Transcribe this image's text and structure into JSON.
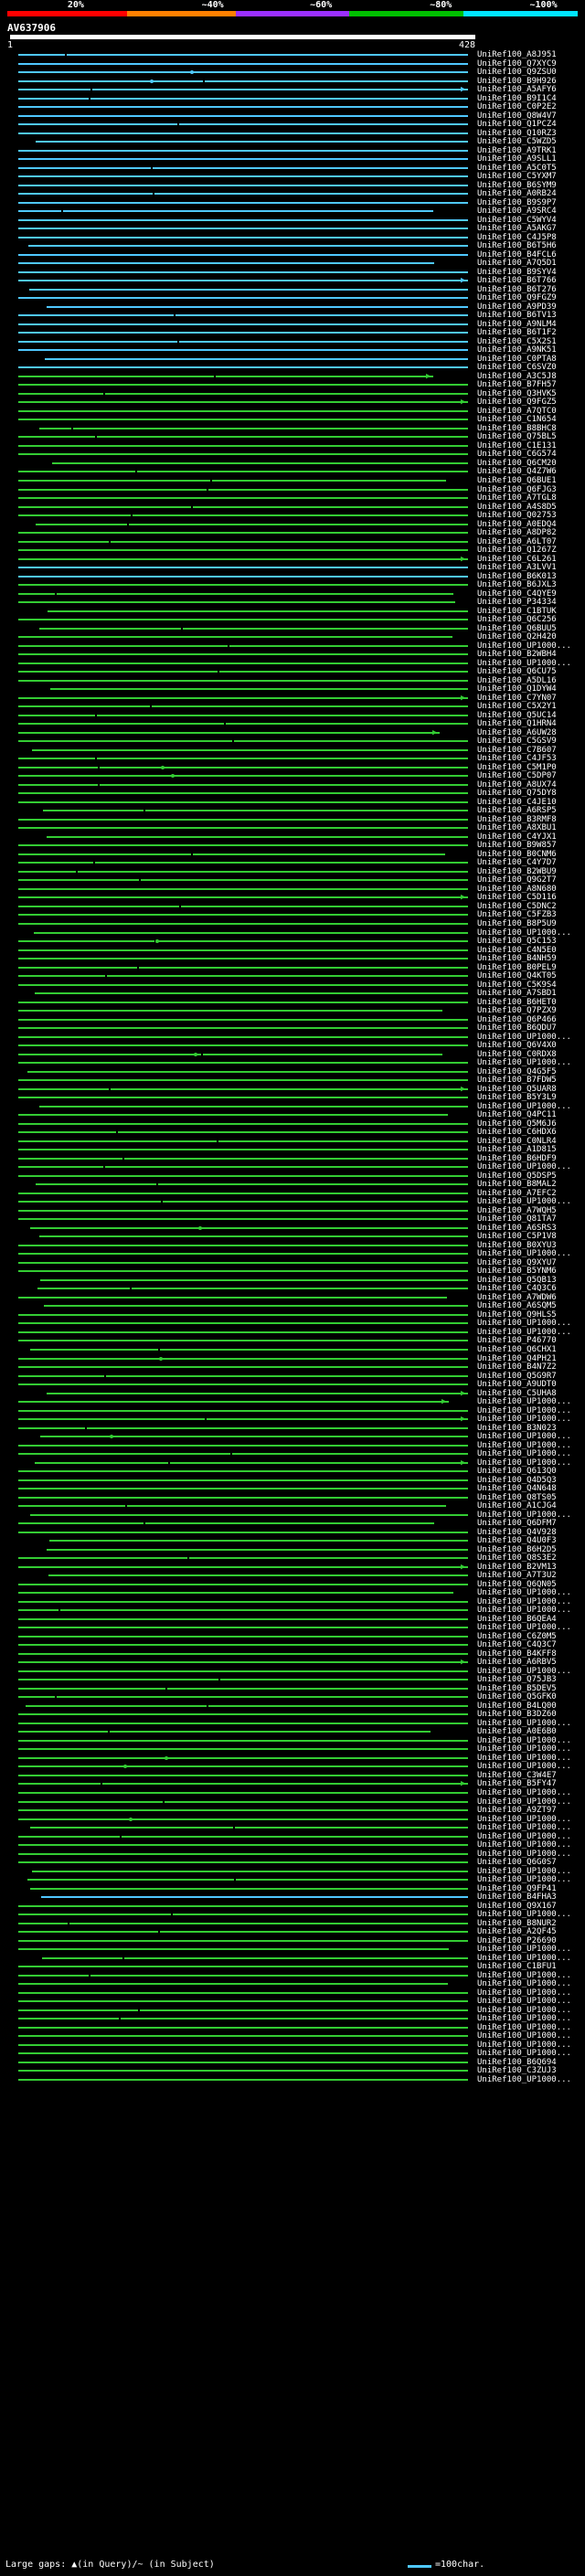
{
  "scale": {
    "labels": [
      "20%",
      "~40%",
      "~60%",
      "~80%",
      "~100%"
    ],
    "colors": [
      "#ff0000",
      "#ff8000",
      "#9b30ff",
      "#00c000",
      "#00e5ff"
    ]
  },
  "query": {
    "id": "AV637906",
    "start": "1",
    "end": "428"
  },
  "colors": {
    "green": "#33cc33",
    "cyan": "#4fc8ff",
    "dark_green": "#1a7a1a"
  },
  "hits": [
    {
      "acc": "UniRef100_A8J951",
      "color": "cyan"
    },
    {
      "acc": "UniRef100_Q7XYC9",
      "color": "cyan"
    },
    {
      "acc": "UniRef100_Q9ZSU0",
      "color": "cyan"
    },
    {
      "acc": "UniRef100_B9H926",
      "color": "cyan"
    },
    {
      "acc": "UniRef100_A5AFY6",
      "color": "cyan"
    },
    {
      "acc": "UniRef100_B9I1C4",
      "color": "cyan"
    },
    {
      "acc": "UniRef100_C0P2E2",
      "color": "cyan"
    },
    {
      "acc": "UniRef100_Q8W4V7",
      "color": "cyan"
    },
    {
      "acc": "UniRef100_Q1PCZ4",
      "color": "cyan"
    },
    {
      "acc": "UniRef100_Q10RZ3",
      "color": "cyan"
    },
    {
      "acc": "UniRef100_C5WZD5",
      "color": "cyan"
    },
    {
      "acc": "UniRef100_A9TRK1",
      "color": "cyan"
    },
    {
      "acc": "UniRef100_A9SLL1",
      "color": "cyan"
    },
    {
      "acc": "UniRef100_A5C0T5",
      "color": "cyan"
    },
    {
      "acc": "UniRef100_C5YXM7",
      "color": "cyan"
    },
    {
      "acc": "UniRef100_B6SYM9",
      "color": "cyan"
    },
    {
      "acc": "UniRef100_A0RB24",
      "color": "cyan"
    },
    {
      "acc": "UniRef100_B9S9P7",
      "color": "cyan"
    },
    {
      "acc": "UniRef100_A9SRC4",
      "color": "cyan"
    },
    {
      "acc": "UniRef100_C5WYV4",
      "color": "cyan"
    },
    {
      "acc": "UniRef100_A5AKG7",
      "color": "cyan"
    },
    {
      "acc": "UniRef100_C4J5P8",
      "color": "cyan"
    },
    {
      "acc": "UniRef100_B6T5H6",
      "color": "cyan"
    },
    {
      "acc": "UniRef100_B4FCL6",
      "color": "cyan"
    },
    {
      "acc": "UniRef100_A7Q5D1",
      "color": "cyan"
    },
    {
      "acc": "UniRef100_B9SYV4",
      "color": "cyan"
    },
    {
      "acc": "UniRef100_B6T766",
      "color": "cyan"
    },
    {
      "acc": "UniRef100_B6T276",
      "color": "cyan"
    },
    {
      "acc": "UniRef100_Q9FGZ9",
      "color": "cyan"
    },
    {
      "acc": "UniRef100_A9PD39",
      "color": "cyan"
    },
    {
      "acc": "UniRef100_B6TV13",
      "color": "cyan"
    },
    {
      "acc": "UniRef100_A9NLM4",
      "color": "cyan"
    },
    {
      "acc": "UniRef100_B6T1F2",
      "color": "cyan"
    },
    {
      "acc": "UniRef100_C5X2S1",
      "color": "cyan"
    },
    {
      "acc": "UniRef100_A9NK51",
      "color": "cyan"
    },
    {
      "acc": "UniRef100_C0PTA8",
      "color": "cyan"
    },
    {
      "acc": "UniRef100_C6SVZ0",
      "color": "cyan"
    },
    {
      "acc": "UniRef100_A3C5J8",
      "color": "green"
    },
    {
      "acc": "UniRef100_B7FH57",
      "color": "green"
    },
    {
      "acc": "UniRef100_Q3HVK5",
      "color": "green"
    },
    {
      "acc": "UniRef100_Q9FGZ5",
      "color": "green"
    },
    {
      "acc": "UniRef100_A7QTC0",
      "color": "green"
    },
    {
      "acc": "UniRef100_C1N654",
      "color": "green"
    },
    {
      "acc": "UniRef100_B8BHC8",
      "color": "green"
    },
    {
      "acc": "UniRef100_Q75BL5",
      "color": "green"
    },
    {
      "acc": "UniRef100_C1E131",
      "color": "green"
    },
    {
      "acc": "UniRef100_C6G574",
      "color": "green"
    },
    {
      "acc": "UniRef100_Q6CM20",
      "color": "green"
    },
    {
      "acc": "UniRef100_Q4Z7W6",
      "color": "green"
    },
    {
      "acc": "UniRef100_Q6BUE1",
      "color": "green"
    },
    {
      "acc": "UniRef100_Q6FJG3",
      "color": "green"
    },
    {
      "acc": "UniRef100_A7TGL8",
      "color": "green"
    },
    {
      "acc": "UniRef100_A4S8D5",
      "color": "green"
    },
    {
      "acc": "UniRef100_Q02753",
      "color": "green"
    },
    {
      "acc": "UniRef100_A0EDQ4",
      "color": "green"
    },
    {
      "acc": "UniRef100_A8DP82",
      "color": "green"
    },
    {
      "acc": "UniRef100_A6LT07",
      "color": "green"
    },
    {
      "acc": "UniRef100_Q1267Z",
      "color": "green"
    },
    {
      "acc": "UniRef100_C6L261",
      "color": "green"
    },
    {
      "acc": "UniRef100_A3LVV1",
      "color": "cyan"
    },
    {
      "acc": "UniRef100_B6K013",
      "color": "cyan"
    },
    {
      "acc": "UniRef100_B6JXL3",
      "color": "green"
    },
    {
      "acc": "UniRef100_C4QYE9",
      "color": "green"
    },
    {
      "acc": "UniRef100_P34334",
      "color": "green"
    },
    {
      "acc": "UniRef100_C1BTUK",
      "color": "green"
    },
    {
      "acc": "UniRef100_Q6C256",
      "color": "green"
    },
    {
      "acc": "UniRef100_Q6BUU5",
      "color": "green"
    },
    {
      "acc": "UniRef100_Q2H420",
      "color": "green"
    },
    {
      "acc": "UniRef100_UP1000...",
      "color": "green"
    },
    {
      "acc": "UniRef100_B2WBH4",
      "color": "green"
    },
    {
      "acc": "UniRef100_UP1000...",
      "color": "green"
    },
    {
      "acc": "UniRef100_Q6CU75",
      "color": "green"
    },
    {
      "acc": "UniRef100_A5DL16",
      "color": "green"
    },
    {
      "acc": "UniRef100_Q1DYW4",
      "color": "green"
    },
    {
      "acc": "UniRef100_C7YN07",
      "color": "green"
    },
    {
      "acc": "UniRef100_C5X2Y1",
      "color": "green"
    },
    {
      "acc": "UniRef100_Q5UC14",
      "color": "green"
    },
    {
      "acc": "UniRef100_Q1HRN4",
      "color": "green"
    },
    {
      "acc": "UniRef100_A6UW28",
      "color": "green"
    },
    {
      "acc": "UniRef100_C5GSV9",
      "color": "green"
    },
    {
      "acc": "UniRef100_C7B607",
      "color": "green"
    },
    {
      "acc": "UniRef100_C4JF53",
      "color": "green"
    },
    {
      "acc": "UniRef100_C5M1P0",
      "color": "green"
    },
    {
      "acc": "UniRef100_C5DP07",
      "color": "green"
    },
    {
      "acc": "UniRef100_A8UX74",
      "color": "green"
    },
    {
      "acc": "UniRef100_Q75DY8",
      "color": "green"
    },
    {
      "acc": "UniRef100_C4JE10",
      "color": "green"
    },
    {
      "acc": "UniRef100_A6RSP5",
      "color": "green"
    },
    {
      "acc": "UniRef100_B3RMF8",
      "color": "green"
    },
    {
      "acc": "UniRef100_A8XBU1",
      "color": "green"
    },
    {
      "acc": "UniRef100_C4YJX1",
      "color": "green"
    },
    {
      "acc": "UniRef100_B9W857",
      "color": "green"
    },
    {
      "acc": "UniRef100_B0CNM6",
      "color": "green"
    },
    {
      "acc": "UniRef100_C4Y7D7",
      "color": "green"
    },
    {
      "acc": "UniRef100_B2WBU9",
      "color": "green"
    },
    {
      "acc": "UniRef100_Q9G2T7",
      "color": "green"
    },
    {
      "acc": "UniRef100_A8N680",
      "color": "green"
    },
    {
      "acc": "UniRef100_C5D116",
      "color": "green"
    },
    {
      "acc": "UniRef100_C5DNC2",
      "color": "green"
    },
    {
      "acc": "UniRef100_C5FZB3",
      "color": "green"
    },
    {
      "acc": "UniRef100_B8P5U9",
      "color": "green"
    },
    {
      "acc": "UniRef100_UP1000...",
      "color": "green"
    },
    {
      "acc": "UniRef100_Q5C153",
      "color": "green"
    },
    {
      "acc": "UniRef100_C4N5E0",
      "color": "green"
    },
    {
      "acc": "UniRef100_B4NH59",
      "color": "green"
    },
    {
      "acc": "UniRef100_B0PEL9",
      "color": "green"
    },
    {
      "acc": "UniRef100_Q4KT05",
      "color": "green"
    },
    {
      "acc": "UniRef100_C5K9S4",
      "color": "green"
    },
    {
      "acc": "UniRef100_A7SBD1",
      "color": "green"
    },
    {
      "acc": "UniRef100_B6HET0",
      "color": "green"
    },
    {
      "acc": "UniRef100_Q7PZX9",
      "color": "green"
    },
    {
      "acc": "UniRef100_Q6P466",
      "color": "green"
    },
    {
      "acc": "UniRef100_B6QDU7",
      "color": "green"
    },
    {
      "acc": "UniRef100_UP1000...",
      "color": "green"
    },
    {
      "acc": "UniRef100_Q6V4X0",
      "color": "green"
    },
    {
      "acc": "UniRef100_C0RDX8",
      "color": "green"
    },
    {
      "acc": "UniRef100_UP1000...",
      "color": "green"
    },
    {
      "acc": "UniRef100_Q4G5F5",
      "color": "green"
    },
    {
      "acc": "UniRef100_B7FDW5",
      "color": "green"
    },
    {
      "acc": "UniRef100_Q5UAR8",
      "color": "green"
    },
    {
      "acc": "UniRef100_B5Y3L9",
      "color": "green"
    },
    {
      "acc": "UniRef100_UP1000...",
      "color": "green"
    },
    {
      "acc": "UniRef100_Q4PC11",
      "color": "green"
    },
    {
      "acc": "UniRef100_Q5M6J6",
      "color": "green"
    },
    {
      "acc": "UniRef100_C6HDX6",
      "color": "green"
    },
    {
      "acc": "UniRef100_C0NLR4",
      "color": "green"
    },
    {
      "acc": "UniRef100_A1D815",
      "color": "green"
    },
    {
      "acc": "UniRef100_B6HDF9",
      "color": "green"
    },
    {
      "acc": "UniRef100_UP1000...",
      "color": "green"
    },
    {
      "acc": "UniRef100_Q5DSP5",
      "color": "green"
    },
    {
      "acc": "UniRef100_B8MAL2",
      "color": "green"
    },
    {
      "acc": "UniRef100_A7EFC2",
      "color": "green"
    },
    {
      "acc": "UniRef100_UP1000...",
      "color": "green"
    },
    {
      "acc": "UniRef100_A7WQH5",
      "color": "green"
    },
    {
      "acc": "UniRef100_Q81TA7",
      "color": "green"
    },
    {
      "acc": "UniRef100_A6SRS3",
      "color": "green"
    },
    {
      "acc": "UniRef100_C5P1V8",
      "color": "green"
    },
    {
      "acc": "UniRef100_B0XYU3",
      "color": "green"
    },
    {
      "acc": "UniRef100_UP1000...",
      "color": "green"
    },
    {
      "acc": "UniRef100_Q9XYU7",
      "color": "green"
    },
    {
      "acc": "UniRef100_B5YNM6",
      "color": "green"
    },
    {
      "acc": "UniRef100_Q5QB13",
      "color": "green"
    },
    {
      "acc": "UniRef100_C4Q3C6",
      "color": "green"
    },
    {
      "acc": "UniRef100_A7WDW6",
      "color": "green"
    },
    {
      "acc": "UniRef100_A6SQM5",
      "color": "green"
    },
    {
      "acc": "UniRef100_Q9HLS5",
      "color": "green"
    },
    {
      "acc": "UniRef100_UP1000...",
      "color": "green"
    },
    {
      "acc": "UniRef100_UP1000...",
      "color": "green"
    },
    {
      "acc": "UniRef100_P46770",
      "color": "green"
    },
    {
      "acc": "UniRef100_Q6CHX1",
      "color": "green"
    },
    {
      "acc": "UniRef100_Q4PH21",
      "color": "green"
    },
    {
      "acc": "UniRef100_B4N7Z2",
      "color": "green"
    },
    {
      "acc": "UniRef100_Q5G9R7",
      "color": "green"
    },
    {
      "acc": "UniRef100_A9UDT0",
      "color": "green"
    },
    {
      "acc": "UniRef100_C5UHA8",
      "color": "green"
    },
    {
      "acc": "UniRef100_UP1000...",
      "color": "green"
    },
    {
      "acc": "UniRef100_UP1000...",
      "color": "green"
    },
    {
      "acc": "UniRef100_UP1000...",
      "color": "green"
    },
    {
      "acc": "UniRef100_B3N023",
      "color": "green"
    },
    {
      "acc": "UniRef100_UP1000...",
      "color": "green"
    },
    {
      "acc": "UniRef100_UP1000...",
      "color": "green"
    },
    {
      "acc": "UniRef100_UP1000...",
      "color": "green"
    },
    {
      "acc": "UniRef100_UP1000...",
      "color": "green"
    },
    {
      "acc": "UniRef100_Q613Q0",
      "color": "green"
    },
    {
      "acc": "UniRef100_Q4D5Q3",
      "color": "green"
    },
    {
      "acc": "UniRef100_Q4N648",
      "color": "green"
    },
    {
      "acc": "UniRef100_Q8TS05",
      "color": "green"
    },
    {
      "acc": "UniRef100_A1CJG4",
      "color": "green"
    },
    {
      "acc": "UniRef100_UP1000...",
      "color": "green"
    },
    {
      "acc": "UniRef100_Q6DFM7",
      "color": "green"
    },
    {
      "acc": "UniRef100_Q4V928",
      "color": "green"
    },
    {
      "acc": "UniRef100_Q4U0F3",
      "color": "green"
    },
    {
      "acc": "UniRef100_B6H2D5",
      "color": "green"
    },
    {
      "acc": "UniRef100_Q8S3E2",
      "color": "green"
    },
    {
      "acc": "UniRef100_B2VM13",
      "color": "green"
    },
    {
      "acc": "UniRef100_A7T3U2",
      "color": "green"
    },
    {
      "acc": "UniRef100_Q6QN05",
      "color": "green"
    },
    {
      "acc": "UniRef100_UP1000...",
      "color": "green"
    },
    {
      "acc": "UniRef100_UP1000...",
      "color": "green"
    },
    {
      "acc": "UniRef100_UP1000...",
      "color": "green"
    },
    {
      "acc": "UniRef100_B6QEA4",
      "color": "green"
    },
    {
      "acc": "UniRef100_UP1000...",
      "color": "green"
    },
    {
      "acc": "UniRef100_C6Z0M5",
      "color": "green"
    },
    {
      "acc": "UniRef100_C4Q3C7",
      "color": "green"
    },
    {
      "acc": "UniRef100_B4KFF8",
      "color": "green"
    },
    {
      "acc": "UniRef100_A6RBV5",
      "color": "green"
    },
    {
      "acc": "UniRef100_UP1000...",
      "color": "green"
    },
    {
      "acc": "UniRef100_Q75JB3",
      "color": "green"
    },
    {
      "acc": "UniRef100_B5DEV5",
      "color": "green"
    },
    {
      "acc": "UniRef100_Q5GFK0",
      "color": "green"
    },
    {
      "acc": "UniRef100_B4LQ00",
      "color": "green"
    },
    {
      "acc": "UniRef100_B3DZ60",
      "color": "green"
    },
    {
      "acc": "UniRef100_UP1000...",
      "color": "green"
    },
    {
      "acc": "UniRef100_A0E6B0",
      "color": "green"
    },
    {
      "acc": "UniRef100_UP1000...",
      "color": "green"
    },
    {
      "acc": "UniRef100_UP1000...",
      "color": "green"
    },
    {
      "acc": "UniRef100_UP1000...",
      "color": "green"
    },
    {
      "acc": "UniRef100_UP1000...",
      "color": "green"
    },
    {
      "acc": "UniRef100_C3W4E7",
      "color": "green"
    },
    {
      "acc": "UniRef100_B5FY47",
      "color": "green"
    },
    {
      "acc": "UniRef100_UP1000...",
      "color": "green"
    },
    {
      "acc": "UniRef100_UP1000...",
      "color": "green"
    },
    {
      "acc": "UniRef100_A9ZT97",
      "color": "green"
    },
    {
      "acc": "UniRef100_UP1000...",
      "color": "green"
    },
    {
      "acc": "UniRef100_UP1000...",
      "color": "green"
    },
    {
      "acc": "UniRef100_UP1000...",
      "color": "green"
    },
    {
      "acc": "UniRef100_UP1000...",
      "color": "green"
    },
    {
      "acc": "UniRef100_UP1000...",
      "color": "green"
    },
    {
      "acc": "UniRef100_Q6G0S7",
      "color": "green"
    },
    {
      "acc": "UniRef100_UP1000...",
      "color": "green"
    },
    {
      "acc": "UniRef100_UP1000...",
      "color": "green"
    },
    {
      "acc": "UniRef100_Q9FP41",
      "color": "green"
    },
    {
      "acc": "UniRef100_B4FHA3",
      "color": "cyan"
    },
    {
      "acc": "UniRef100_Q9X167",
      "color": "green"
    },
    {
      "acc": "UniRef100_UP1000...",
      "color": "green"
    },
    {
      "acc": "UniRef100_B8NUR2",
      "color": "green"
    },
    {
      "acc": "UniRef100_A2QF45",
      "color": "green"
    },
    {
      "acc": "UniRef100_P26690",
      "color": "green"
    },
    {
      "acc": "UniRef100_UP1000...",
      "color": "green"
    },
    {
      "acc": "UniRef100_UP1000...",
      "color": "green"
    },
    {
      "acc": "UniRef100_C1BFU1",
      "color": "green"
    },
    {
      "acc": "UniRef100_UP1000...",
      "color": "green"
    },
    {
      "acc": "UniRef100_UP1000...",
      "color": "green"
    },
    {
      "acc": "UniRef100_UP1000...",
      "color": "green"
    },
    {
      "acc": "UniRef100_UP1000...",
      "color": "green"
    },
    {
      "acc": "UniRef100_UP1000...",
      "color": "green"
    },
    {
      "acc": "UniRef100_UP1000...",
      "color": "green"
    },
    {
      "acc": "UniRef100_UP1000...",
      "color": "green"
    },
    {
      "acc": "UniRef100_UP1000...",
      "color": "green"
    },
    {
      "acc": "UniRef100_UP1000...",
      "color": "green"
    },
    {
      "acc": "UniRef100_UP1000...",
      "color": "green"
    },
    {
      "acc": "UniRef100_B6Q694",
      "color": "green"
    },
    {
      "acc": "UniRef100_C3ZUJ3",
      "color": "green"
    },
    {
      "acc": "UniRef100_UP1000...",
      "color": "green"
    }
  ],
  "legend": {
    "gaps_label": "Large gaps: ▲(in Query)/~ (in Subject)",
    "scale_label": "=100char."
  }
}
